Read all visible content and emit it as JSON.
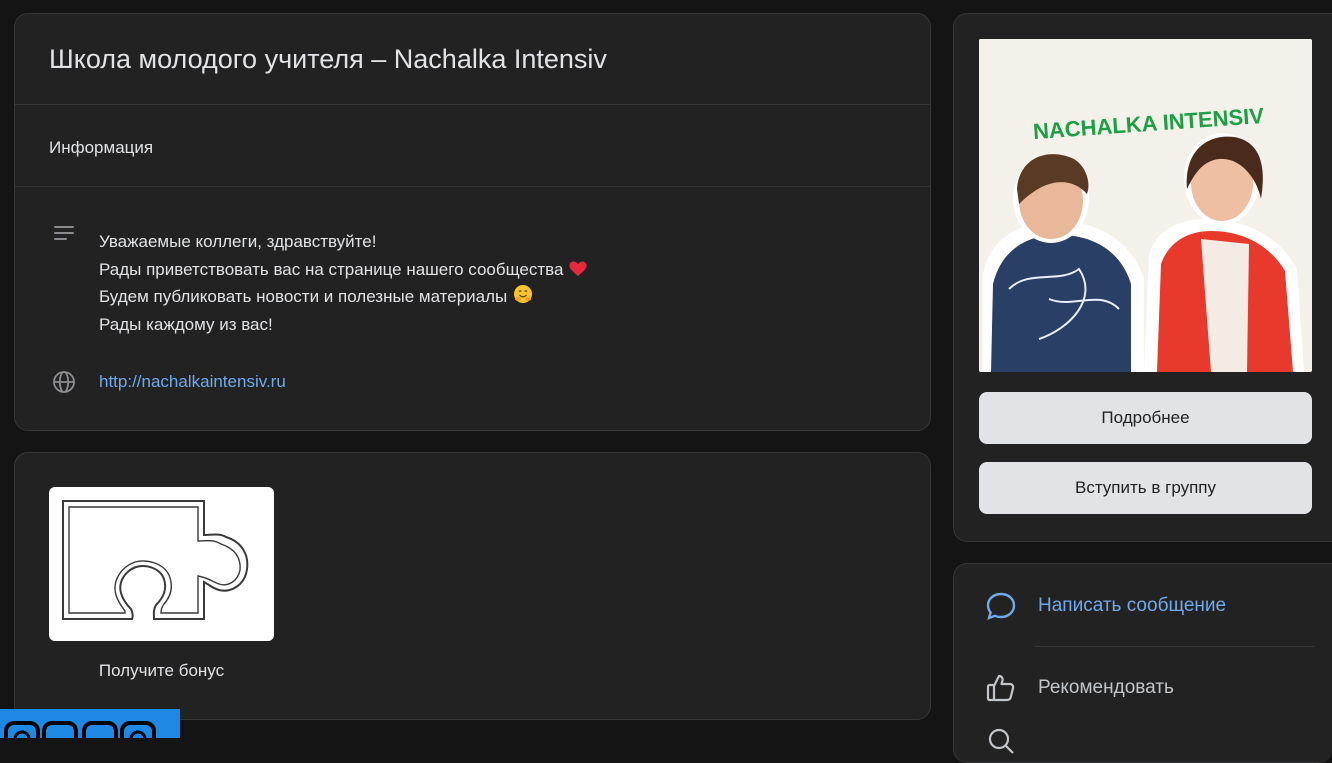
{
  "group": {
    "title": "Школа молодого учителя – Nachalka Intensiv",
    "section_label": "Информация",
    "description_lines": [
      "Уважаемые коллеги, здравствуйте!",
      "Рады приветствовать вас на странице нашего сообщества",
      "Будем публиковать новости и полезные материалы",
      "Рады каждому из вас!"
    ],
    "website": "http://nachalkaintensiv.ru"
  },
  "app": {
    "label": "Получите бонус",
    "icon": "puzzle-piece-icon"
  },
  "cover": {
    "brand_text": "NACHALKA INTENSIV"
  },
  "buttons": {
    "more": "Подробнее",
    "join": "Вступить в группу"
  },
  "actions": {
    "write_message": "Написать сообщение",
    "recommend": "Рекомендовать"
  },
  "colors": {
    "background": "#141414",
    "card": "#222222",
    "link": "#71aaeb",
    "button": "#e1e3e6",
    "brand_green": "#1e9e45",
    "badge_blue": "#1e88e5"
  }
}
